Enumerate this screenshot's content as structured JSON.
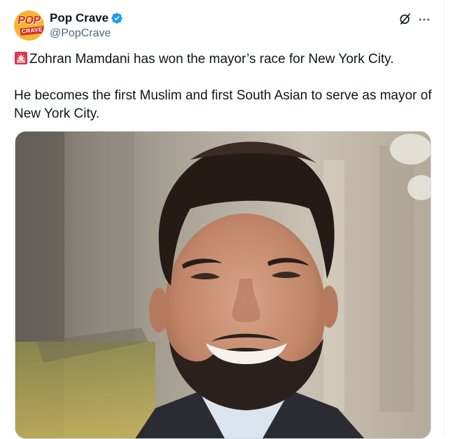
{
  "author": {
    "display_name": "Pop Crave",
    "handle": "@PopCrave",
    "verified": true,
    "avatar_text_top": "POP",
    "avatar_text_bottom": "CRAVE"
  },
  "icons": {
    "alert": "police-car-light-emoji",
    "verified": "verified-badge-icon",
    "grok": "grok-icon",
    "more": "more-horizontal-icon"
  },
  "tweet": {
    "line1": "Zohran Mamdani has won the mayor’s race for New York City.",
    "line2": "He becomes the first Muslim and first South Asian to serve as mayor of New York City."
  },
  "colors": {
    "verified_badge": "#1d9bf0",
    "handle_gray": "#536471",
    "alert_red": "#e0314b"
  }
}
